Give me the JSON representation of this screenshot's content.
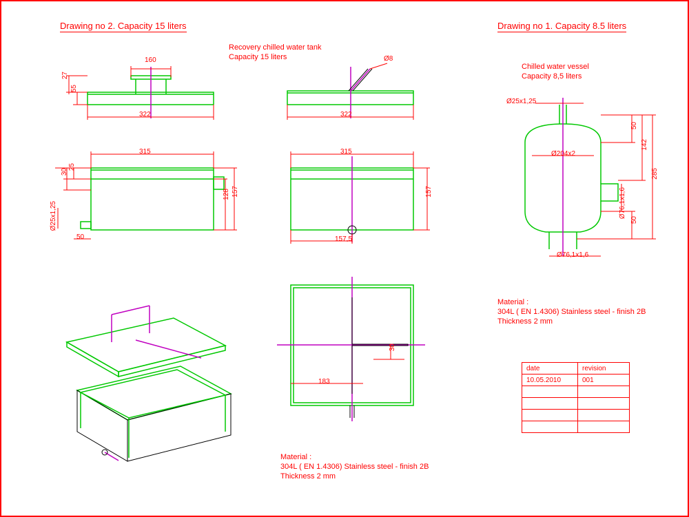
{
  "drawing2": {
    "title": "Drawing no 2. Capacity   15 liters",
    "desc1": "Recovery chilled water tank",
    "desc2": "Capacity  15 liters",
    "dims": {
      "d160": "160",
      "d322a": "322",
      "d27": "27",
      "d55": "55",
      "d322b": "322",
      "d315a": "315",
      "d315b": "315",
      "d25": "25",
      "d30a": "30",
      "d128": "128",
      "d157a": "157",
      "d157b": "157",
      "d1575": "157,5",
      "d50": "50",
      "d183": "183",
      "d30b": "30",
      "d8": "Ø8",
      "d25x125": "Ø25x1,25"
    },
    "material1": "Material :",
    "material2": "304L ( EN 1.4306) Stainless steel - finish 2B",
    "material3": "Thickness 2 mm"
  },
  "drawing1": {
    "title": "Drawing no 1. Capacity   8.5 liters",
    "desc1": "Chilled water vessel",
    "desc2": "Capacity  8,5 liters",
    "dims": {
      "d25x125": "Ø25x1,25",
      "d204x2": "Ø204x2",
      "d50a": "50",
      "d142": "142",
      "d285": "285",
      "d50b": "50",
      "d761x16a": "Ø76,1x1,6",
      "d761x16b": "Ø76,1x1,6"
    },
    "material1": "Material :",
    "material2": "304L ( EN 1.4306) Stainless steel - finish 2B",
    "material3": "Thickness 2 mm"
  },
  "revtable": {
    "h1": "date",
    "h2": "revision",
    "date": "10.05.2010",
    "rev": "001"
  }
}
